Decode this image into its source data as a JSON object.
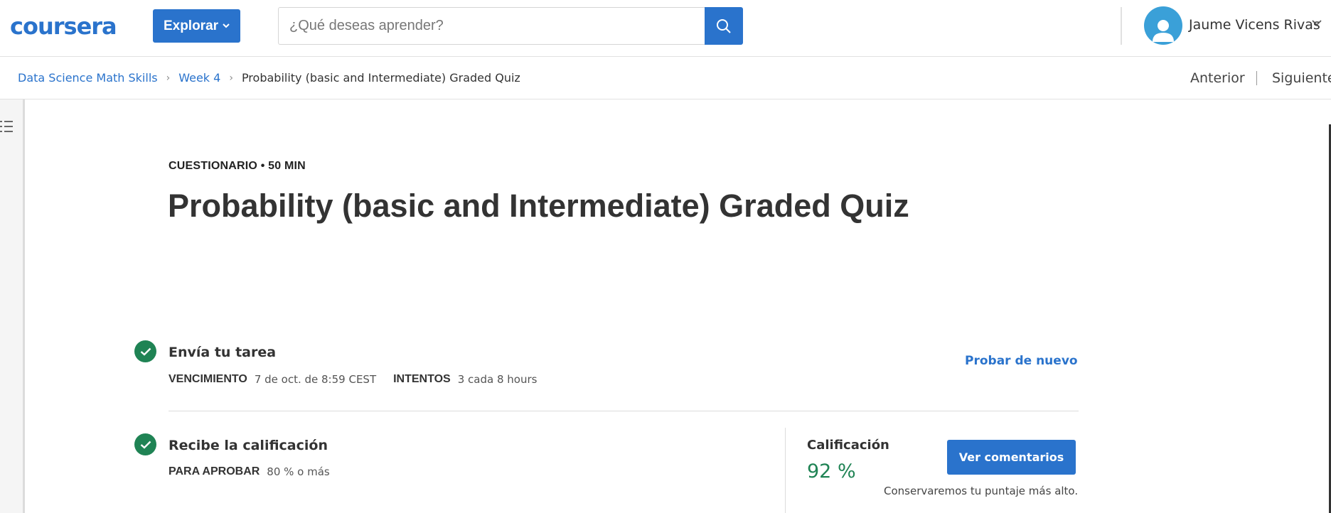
{
  "header": {
    "logo": "coursera",
    "explore_label": "Explorar",
    "search_placeholder": "¿Qué deseas aprender?",
    "user_name": "Jaume Vicens Rivas"
  },
  "breadcrumb": {
    "items": [
      "Data Science Math Skills",
      "Week 4",
      "Probability (basic and Intermediate) Graded Quiz"
    ],
    "prev_label": "Anterior",
    "next_label": "Siguiente"
  },
  "quiz": {
    "kicker": "CUESTIONARIO • 50 MIN",
    "title": "Probability (basic and Intermediate) Graded Quiz",
    "submit": {
      "title": "Envía tu tarea",
      "due_key": "VENCIMIENTO",
      "due_value": "7 de oct. de 8:59 CEST",
      "attempts_key": "INTENTOS",
      "attempts_value": "3 cada 8 hours",
      "retry_label": "Probar de nuevo"
    },
    "grade": {
      "title": "Recibe la calificación",
      "pass_key": "PARA APROBAR",
      "pass_value": "80 % o más",
      "label": "Calificación",
      "value": "92 %",
      "feedback_label": "Ver comentarios",
      "note": "Conservaremos tu puntaje más alto."
    }
  },
  "colors": {
    "brand": "#2a73cc",
    "success": "#1f8354"
  },
  "icons": [
    "search-icon",
    "chevron-down-icon",
    "user-icon",
    "menu-icon",
    "check-icon"
  ]
}
